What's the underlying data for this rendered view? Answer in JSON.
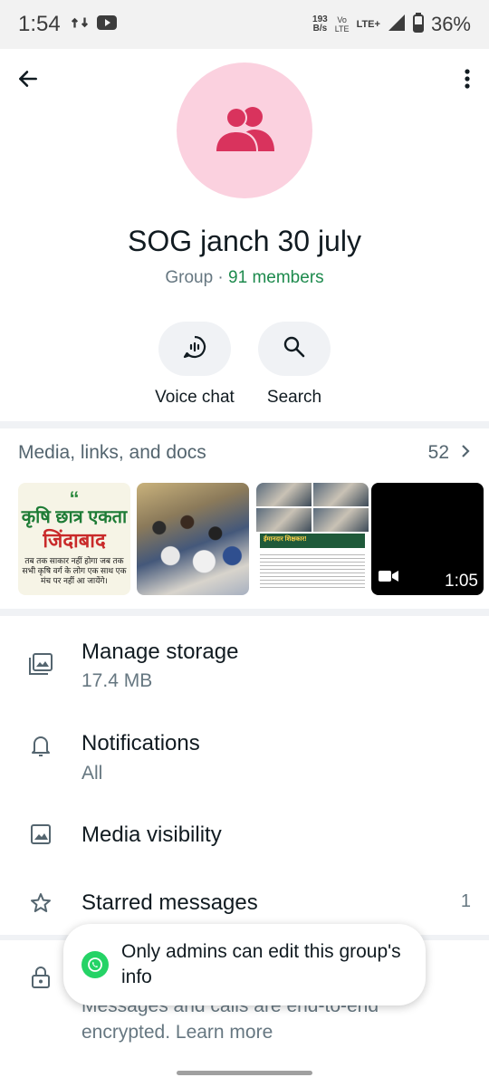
{
  "status_bar": {
    "time": "1:54",
    "net_speed_value": "193",
    "net_speed_unit": "B/s",
    "volte_top": "Vo",
    "volte_bottom": "LTE",
    "lte": "LTE+",
    "battery": "36%"
  },
  "group": {
    "name": "SOG janch 30 july",
    "type_label": "Group · ",
    "members": "91 members",
    "avatar_icon": "group-icon",
    "avatar_bg": "#fbd1df",
    "avatar_fg": "#d9335d"
  },
  "actions": [
    {
      "label": "Voice chat",
      "icon": "voice-chat-icon"
    },
    {
      "label": "Search",
      "icon": "search-icon"
    }
  ],
  "media": {
    "title": "Media, links, and docs",
    "count": "52",
    "thumb1": {
      "quote": "“",
      "line1": "कृषि छात्र एकता",
      "line2": "जिंदाबाद",
      "line3": "तब तक साकार नहीं होगा जब तक सभी कृषि वर्ग के लोग एक साथ एक मंच पर नहीं आ जायेंगे।"
    },
    "thumb3": {
      "band_text": "ईमानदार शिक्षकार!"
    },
    "video_duration": "1:05"
  },
  "settings": [
    {
      "title": "Manage storage",
      "sub": "17.4 MB",
      "icon": "storage-icon"
    },
    {
      "title": "Notifications",
      "sub": "All",
      "icon": "bell-icon"
    },
    {
      "title": "Media visibility",
      "icon": "image-icon"
    },
    {
      "title": "Starred messages",
      "trail": "1",
      "icon": "star-icon"
    }
  ],
  "encryption": {
    "icon": "lock-icon",
    "text": "Messages and calls are end-to-end encrypted. Learn more"
  },
  "toast": {
    "message": "Only admins can edit this group's info",
    "icon": "whatsapp-icon"
  },
  "colors": {
    "accent_green": "#1d8a4d",
    "whatsapp_green": "#25d366",
    "text_primary": "#111b21",
    "text_secondary": "#667781"
  }
}
